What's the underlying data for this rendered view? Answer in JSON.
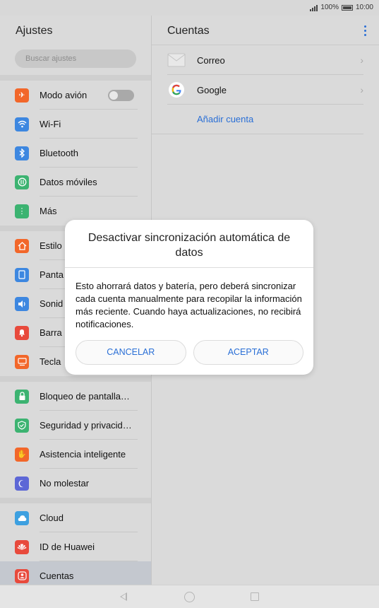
{
  "status": {
    "battery_text": "100%",
    "time": "10:00"
  },
  "left": {
    "title": "Ajustes",
    "search_placeholder": "Buscar ajustes",
    "group1": [
      {
        "label": "Modo avión",
        "icon": "airplane-icon",
        "color": "#f2672a"
      },
      {
        "label": "Wi-Fi",
        "icon": "wifi-icon",
        "color": "#3d87e0"
      },
      {
        "label": "Bluetooth",
        "icon": "bluetooth-icon",
        "color": "#3d87e0"
      },
      {
        "label": "Datos móviles",
        "icon": "mobile-data-icon",
        "color": "#3cb371"
      },
      {
        "label": "Más",
        "icon": "more-icon",
        "color": "#3cb371"
      }
    ],
    "group2": [
      {
        "label": "Estilo",
        "icon": "home-style-icon",
        "color": "#f2672a"
      },
      {
        "label": "Panta",
        "icon": "display-icon",
        "color": "#3d87e0"
      },
      {
        "label": "Sonid",
        "icon": "sound-icon",
        "color": "#3d87e0"
      },
      {
        "label": "Barra",
        "icon": "notification-bell-icon",
        "color": "#e84a3c"
      },
      {
        "label": "Tecla",
        "icon": "keyboard-icon",
        "color": "#f2672a"
      }
    ],
    "group3": [
      {
        "label": "Bloqueo de pantalla…",
        "icon": "lock-icon",
        "color": "#3cb371"
      },
      {
        "label": "Seguridad y privacid…",
        "icon": "shield-icon",
        "color": "#3cb371"
      },
      {
        "label": "Asistencia inteligente",
        "icon": "hand-icon",
        "color": "#f2672a"
      },
      {
        "label": "No molestar",
        "icon": "moon-icon",
        "color": "#5d67d6"
      }
    ],
    "group4": [
      {
        "label": "Cloud",
        "icon": "cloud-icon",
        "color": "#3da0e0"
      },
      {
        "label": "ID de Huawei",
        "icon": "huawei-icon",
        "color": "#e84a3c"
      },
      {
        "label": "Cuentas",
        "icon": "account-icon",
        "color": "#e84a3c"
      }
    ]
  },
  "right": {
    "title": "Cuentas",
    "accounts": [
      {
        "label": "Correo",
        "icon": "mail-icon"
      },
      {
        "label": "Google",
        "icon": "google-icon"
      }
    ],
    "add_account": "Añadir cuenta"
  },
  "dialog": {
    "title": "Desactivar sincronización automática de datos",
    "body": "Esto ahorrará datos y batería, pero deberá sincronizar cada cuenta manualmente para recopilar la información más reciente. Cuando haya actualizaciones, no recibirá notificaciones.",
    "cancel": "CANCELAR",
    "accept": "ACEPTAR"
  }
}
